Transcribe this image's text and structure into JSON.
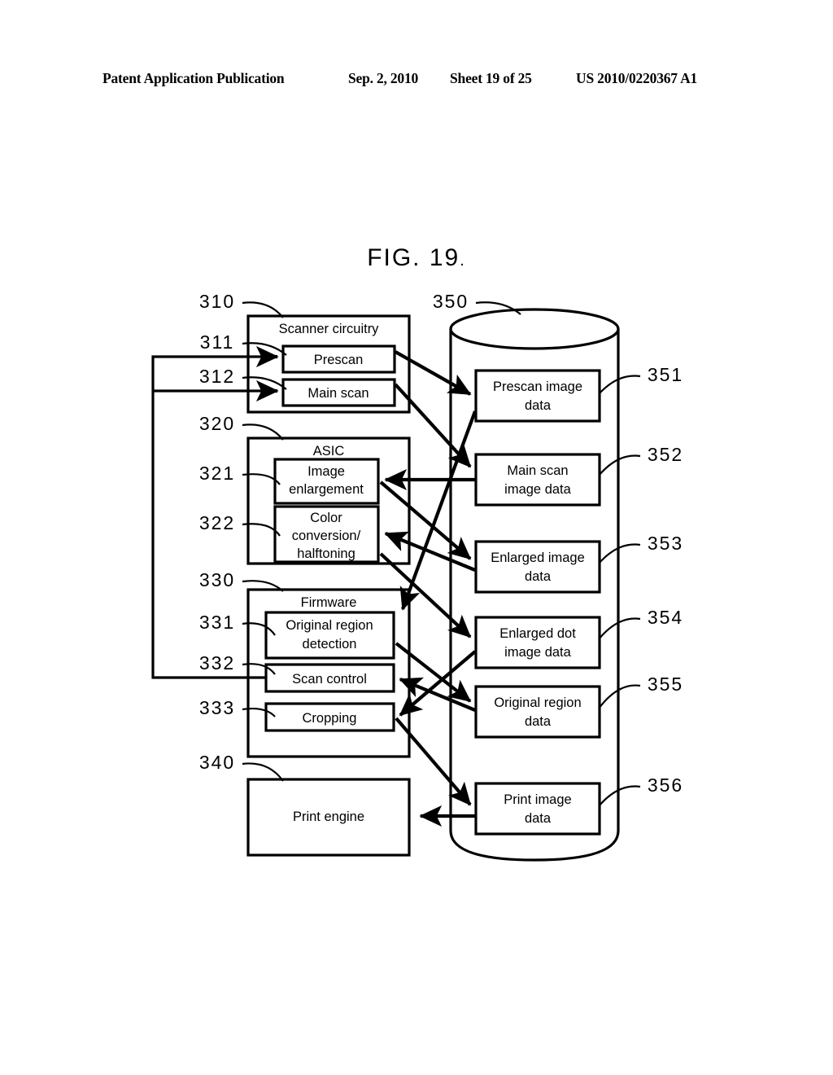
{
  "header": {
    "publication": "Patent Application Publication",
    "date": "Sep. 2, 2010",
    "sheet": "Sheet 19 of 25",
    "number": "US 2010/0220367 A1"
  },
  "figure": {
    "title": "FIG. 19",
    "title_trailing_dot": "."
  },
  "blocks": {
    "scanner": {
      "ref": "310",
      "title": "Scanner circuitry",
      "items": [
        {
          "ref": "311",
          "label": "Prescan"
        },
        {
          "ref": "312",
          "label": "Main scan"
        }
      ]
    },
    "asic": {
      "ref": "320",
      "title": "ASIC",
      "items": [
        {
          "ref": "321",
          "label_line1": "Image",
          "label_line2": "enlargement"
        },
        {
          "ref": "322",
          "label_line1": "Color",
          "label_line2": "conversion/",
          "label_line3": "halftoning"
        }
      ]
    },
    "firmware": {
      "ref": "330",
      "title": "Firmware",
      "items": [
        {
          "ref": "331",
          "label_line1": "Original region",
          "label_line2": "detection"
        },
        {
          "ref": "332",
          "label_line1": "Scan control"
        },
        {
          "ref": "333",
          "label_line1": "Cropping"
        }
      ]
    },
    "print_engine": {
      "ref": "340",
      "label": "Print engine"
    }
  },
  "storage": {
    "ref": "350",
    "items": [
      {
        "ref": "351",
        "line1": "Prescan image",
        "line2": "data"
      },
      {
        "ref": "352",
        "line1": "Main scan",
        "line2": "image data"
      },
      {
        "ref": "353",
        "line1": "Enlarged image",
        "line2": "data"
      },
      {
        "ref": "354",
        "line1": "Enlarged dot",
        "line2": "image data"
      },
      {
        "ref": "355",
        "line1": "Original region",
        "line2": "data"
      },
      {
        "ref": "356",
        "line1": "Print image",
        "line2": "data"
      }
    ]
  },
  "flows": [
    {
      "from": "prescan",
      "to": "prescan-image-data"
    },
    {
      "from": "main-scan",
      "to": "main-scan-image-data"
    },
    {
      "from": "main-scan-image-data",
      "to": "image-enlargement"
    },
    {
      "from": "image-enlargement",
      "to": "enlarged-image-data"
    },
    {
      "from": "enlarged-image-data",
      "to": "color-conversion-halftoning"
    },
    {
      "from": "color-conversion-halftoning",
      "to": "enlarged-dot-image-data"
    },
    {
      "from": "prescan-image-data",
      "to": "original-region-detection"
    },
    {
      "from": "original-region-detection",
      "to": "original-region-data"
    },
    {
      "from": "enlarged-dot-image-data",
      "to": "cropping"
    },
    {
      "from": "original-region-data",
      "to": "scan-control"
    },
    {
      "from": "cropping",
      "to": "print-image-data"
    },
    {
      "from": "print-image-data",
      "to": "print-engine"
    },
    {
      "from": "scan-control",
      "to": "prescan"
    },
    {
      "from": "scan-control",
      "to": "main-scan"
    }
  ],
  "colors": {
    "ink": "#000000",
    "paper": "#ffffff"
  }
}
